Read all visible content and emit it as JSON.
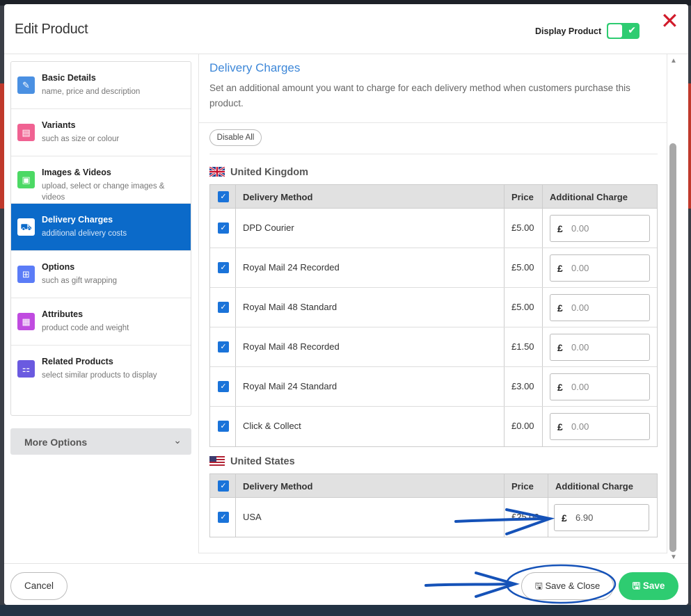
{
  "header": {
    "title": "Edit Product",
    "display_product_label": "Display Product",
    "toggle_on": true,
    "close_symbol": "✕"
  },
  "sidebar": {
    "items": [
      {
        "title": "Basic Details",
        "subtitle": "name, price and description",
        "icon": "pencil-icon",
        "color": "#4a90e2",
        "active": false
      },
      {
        "title": "Variants",
        "subtitle": "such as size or colour",
        "icon": "variants-icon",
        "color": "#f06292",
        "active": false
      },
      {
        "title": "Images & Videos",
        "subtitle": "upload, select or change images & videos",
        "icon": "image-icon",
        "color": "#4cd964",
        "active": false
      },
      {
        "title": "Delivery Charges",
        "subtitle": "additional delivery costs",
        "icon": "truck-icon",
        "color": "#0b6ac9",
        "active": true
      },
      {
        "title": "Options",
        "subtitle": "such as gift wrapping",
        "icon": "gift-icon",
        "color": "#5b7cf7",
        "active": false
      },
      {
        "title": "Attributes",
        "subtitle": "product code and weight",
        "icon": "document-icon",
        "color": "#c04be0",
        "active": false
      },
      {
        "title": "Related Products",
        "subtitle": "select similar products to display",
        "icon": "shirts-icon",
        "color": "#6a5ae0",
        "active": false
      }
    ],
    "more_options_label": "More Options"
  },
  "section": {
    "title": "Delivery Charges",
    "description": "Set an additional amount you want to charge for each delivery method when customers purchase this product.",
    "disable_all_label": "Disable All"
  },
  "table_headers": {
    "method": "Delivery Method",
    "price": "Price",
    "additional": "Additional Charge"
  },
  "currency_symbol": "£",
  "uk": {
    "name": "United Kingdom",
    "rows": [
      {
        "method": "DPD Courier",
        "price": "£5.00",
        "charge": "0.00"
      },
      {
        "method": "Royal Mail 24 Recorded",
        "price": "£5.00",
        "charge": "0.00"
      },
      {
        "method": "Royal Mail 48 Standard",
        "price": "£5.00",
        "charge": "0.00"
      },
      {
        "method": "Royal Mail 48 Recorded",
        "price": "£1.50",
        "charge": "0.00"
      },
      {
        "method": "Royal Mail 24 Standard",
        "price": "£3.00",
        "charge": "0.00"
      },
      {
        "method": "Click & Collect",
        "price": "£0.00",
        "charge": "0.00"
      }
    ]
  },
  "us": {
    "name": "United States",
    "rows": [
      {
        "method": "USA",
        "price": "£25.00",
        "charge": "6.90"
      }
    ]
  },
  "footer": {
    "cancel_label": "Cancel",
    "save_close_label": "Save & Close",
    "save_label": "Save"
  },
  "colors": {
    "accent_blue": "#0b6ac9",
    "title_blue": "#3d87d8",
    "save_green": "#2ecc71",
    "close_red": "#d11a2a",
    "annotation_blue": "#1552b8"
  }
}
